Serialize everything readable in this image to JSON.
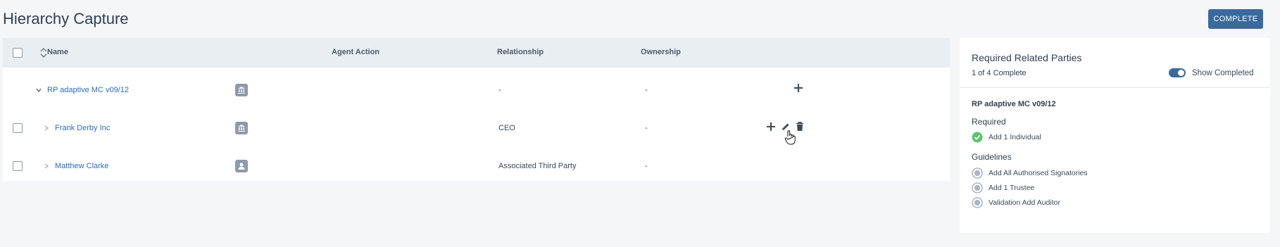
{
  "page": {
    "title": "Hierarchy Capture",
    "complete_label": "COMPLETE"
  },
  "table": {
    "headers": {
      "name": "Name",
      "agent_action": "Agent Action",
      "relationship": "Relationship",
      "ownership": "Ownership"
    },
    "rows": [
      {
        "name": "RP adaptive MC v09/12",
        "type_icon": "building-icon",
        "agent_action": "",
        "relationship": "-",
        "ownership": "-",
        "expanded": true
      },
      {
        "name": "Frank Derby Inc",
        "type_icon": "building-icon",
        "agent_action": "",
        "relationship": "CEO",
        "ownership": "-",
        "expanded": false
      },
      {
        "name": "Matthew Clarke",
        "type_icon": "person-icon",
        "agent_action": "",
        "relationship": "Associated Third Party",
        "ownership": "-",
        "expanded": false
      }
    ]
  },
  "sidebar": {
    "title": "Required Related Parties",
    "progress": "1 of 4 Complete",
    "toggle_label": "Show Completed",
    "toggle_on": true,
    "entity": "RP adaptive MC v09/12",
    "required_heading": "Required",
    "required_items": [
      {
        "label": "Add 1 Individual",
        "status": "complete"
      }
    ],
    "guidelines_heading": "Guidelines",
    "guideline_items": [
      {
        "label": "Add All Authorised Signatories",
        "status": "pending"
      },
      {
        "label": "Add 1 Trustee",
        "status": "pending"
      },
      {
        "label": "Validation Add Auditor",
        "status": "pending"
      }
    ]
  },
  "colors": {
    "accent": "#3a6a9c",
    "link": "#2a6db8",
    "success": "#5cc46a",
    "pending": "#a9b8c8"
  }
}
